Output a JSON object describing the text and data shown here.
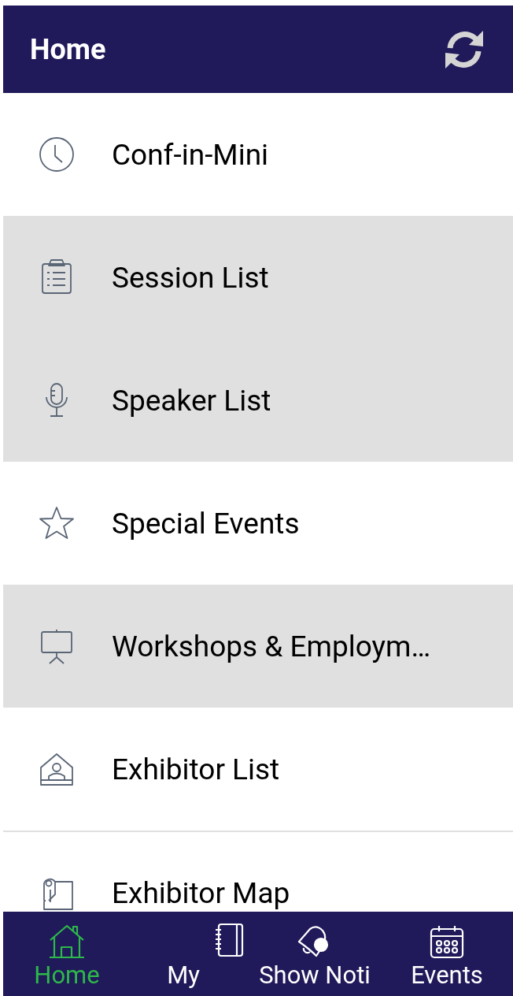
{
  "header": {
    "title": "Home"
  },
  "menu": [
    {
      "label": "Conf-in-Mini",
      "shaded": false
    },
    {
      "label": "Session List",
      "shaded": true
    },
    {
      "label": "Speaker List",
      "shaded": true
    },
    {
      "label": "Special Events",
      "shaded": false
    },
    {
      "label": "Workshops & Employm…",
      "shaded": true
    },
    {
      "label": "Exhibitor List",
      "shaded": false
    },
    {
      "label": "Exhibitor Map",
      "shaded": false
    }
  ],
  "tabs": [
    {
      "label": "Home",
      "selected": true
    },
    {
      "label": "My",
      "selected": false
    },
    {
      "label": "Show Noti",
      "selected": false
    },
    {
      "label": "Events",
      "selected": false
    }
  ]
}
